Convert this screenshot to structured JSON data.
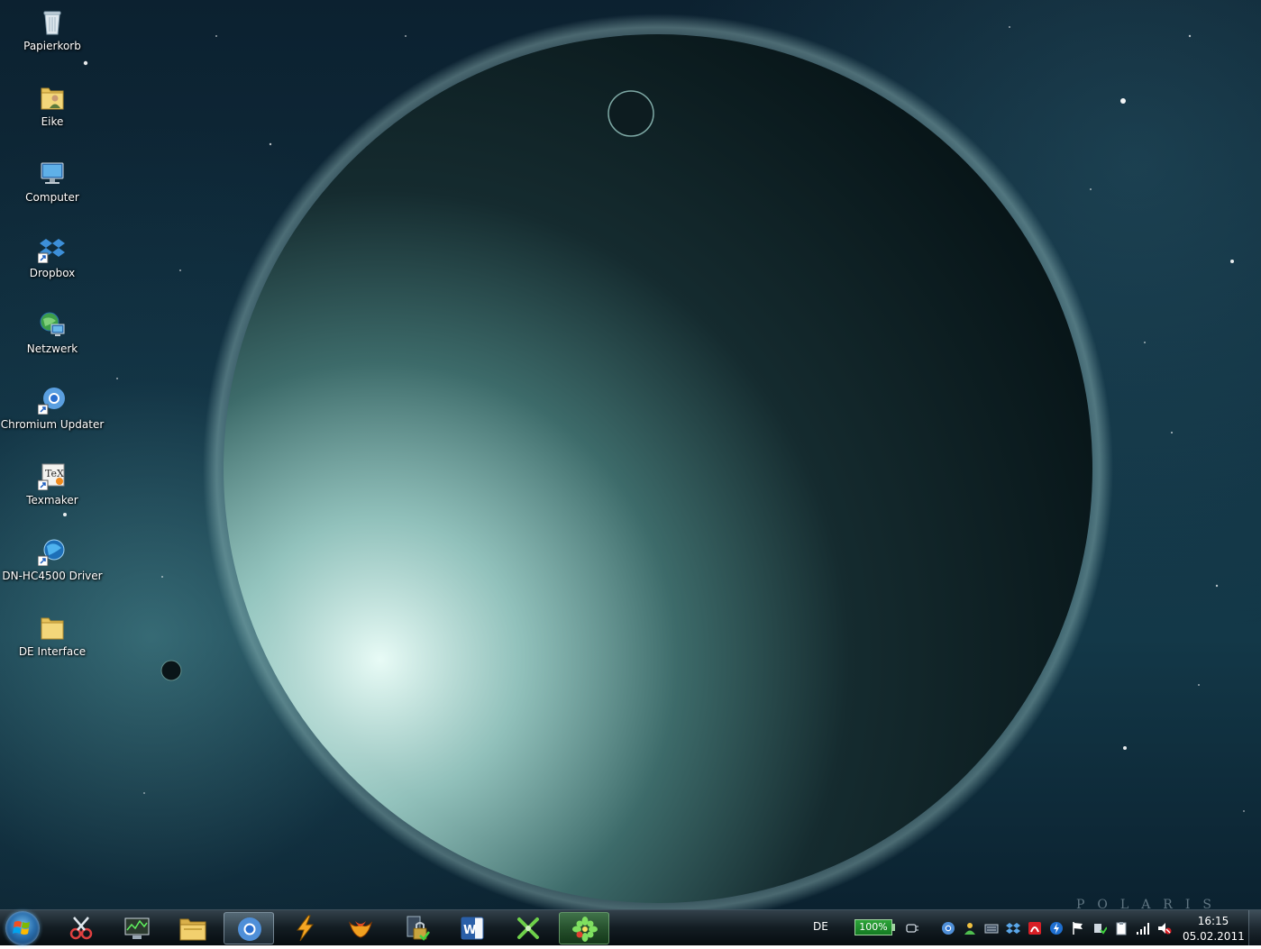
{
  "desktop": {
    "wallpaper_watermark": "POLARIS",
    "icons": [
      {
        "label": "Papierkorb",
        "icon": "recycle-bin-icon"
      },
      {
        "label": "Eike",
        "icon": "user-folder-icon"
      },
      {
        "label": "Computer",
        "icon": "computer-icon"
      },
      {
        "label": "Dropbox",
        "icon": "dropbox-icon"
      },
      {
        "label": "Netzwerk",
        "icon": "network-icon"
      },
      {
        "label": "Chromium Updater",
        "icon": "chromium-updater-icon"
      },
      {
        "label": "Texmaker",
        "icon": "texmaker-icon"
      },
      {
        "label": "DN-HC4500 Driver",
        "icon": "driver-icon"
      },
      {
        "label": "DE Interface",
        "icon": "folder-icon"
      }
    ]
  },
  "taskbar": {
    "start_icon": "windows-start-icon",
    "pinned_apps": [
      {
        "name": "snipping-tool",
        "icon": "scissors-icon",
        "state": "normal"
      },
      {
        "name": "task-manager",
        "icon": "task-manager-icon",
        "state": "normal"
      },
      {
        "name": "windows-explorer",
        "icon": "folder-icon",
        "state": "normal"
      },
      {
        "name": "chromium",
        "icon": "chromium-icon",
        "state": "active"
      },
      {
        "name": "winamp",
        "icon": "lightning-icon",
        "state": "normal"
      },
      {
        "name": "miranda",
        "icon": "flower-icon",
        "state": "normal"
      },
      {
        "name": "vpn-client",
        "icon": "lock-icon",
        "state": "normal"
      },
      {
        "name": "microsoft-word",
        "icon": "word-icon",
        "state": "normal"
      },
      {
        "name": "xmind",
        "icon": "x-tool-icon",
        "state": "normal"
      },
      {
        "name": "icq",
        "icon": "icq-icon",
        "state": "highlighted"
      }
    ],
    "language": "DE",
    "battery_percent": "100%",
    "tray_icons": [
      "power-plug-icon",
      "chromium-tray-icon",
      "user-tray-icon",
      "keyboard-tray-icon",
      "dropbox-tray-icon",
      "antivirus-tray-icon",
      "update-tray-icon",
      "action-center-flag-icon",
      "device-tray-icon",
      "clipboard-tray-icon",
      "signal-bars-icon",
      "volume-muted-icon"
    ],
    "clock": {
      "time": "16:15",
      "date": "05.02.2011"
    }
  },
  "colors": {
    "sky": "#0f2d3d",
    "planet_glow": "#d8f2ef",
    "taskbar": "#0e181e",
    "battery": "#2ea43a"
  }
}
